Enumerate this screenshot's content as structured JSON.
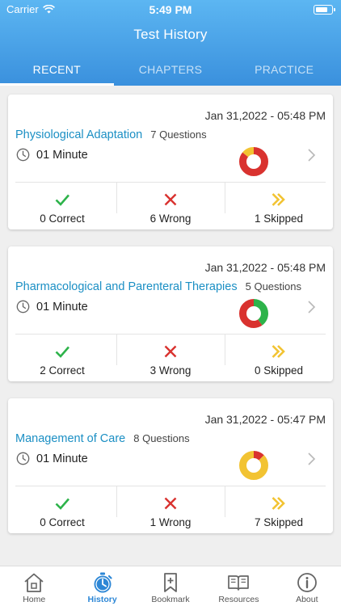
{
  "status_bar": {
    "carrier": "Carrier",
    "time": "5:49 PM"
  },
  "header": {
    "title": "Test History"
  },
  "tabs": [
    {
      "label": "RECENT",
      "active": true
    },
    {
      "label": "CHAPTERS",
      "active": false
    },
    {
      "label": "PRACTICE",
      "active": false
    }
  ],
  "colors": {
    "correct": "#2db34a",
    "wrong": "#d9322f",
    "skipped": "#f2c332",
    "accent": "#3a90dd",
    "link": "#1b8fc4"
  },
  "tests": [
    {
      "date": "Jan 31,2022 - 05:48 PM",
      "subject": "Physiological Adaptation",
      "questions": "7 Questions",
      "duration": "01 Minute",
      "correct": "0 Correct",
      "wrong": "6 Wrong",
      "skipped": "1 Skipped",
      "counts": {
        "correct": 0,
        "wrong": 6,
        "skipped": 1
      }
    },
    {
      "date": "Jan 31,2022 - 05:48 PM",
      "subject": "Pharmacological and Parenteral Therapies",
      "questions": "5 Questions",
      "duration": "01 Minute",
      "correct": "2 Correct",
      "wrong": "3 Wrong",
      "skipped": "0 Skipped",
      "counts": {
        "correct": 2,
        "wrong": 3,
        "skipped": 0
      }
    },
    {
      "date": "Jan 31,2022 - 05:47 PM",
      "subject": "Management of Care",
      "questions": "8 Questions",
      "duration": "01 Minute",
      "correct": "0 Correct",
      "wrong": "1 Wrong",
      "skipped": "7 Skipped",
      "counts": {
        "correct": 0,
        "wrong": 1,
        "skipped": 7
      }
    }
  ],
  "tabbar": [
    {
      "label": "Home",
      "icon": "home-icon",
      "active": false
    },
    {
      "label": "History",
      "icon": "history-icon",
      "active": true
    },
    {
      "label": "Bookmark",
      "icon": "bookmark-icon",
      "active": false
    },
    {
      "label": "Resources",
      "icon": "resources-icon",
      "active": false
    },
    {
      "label": "About",
      "icon": "about-icon",
      "active": false
    }
  ]
}
